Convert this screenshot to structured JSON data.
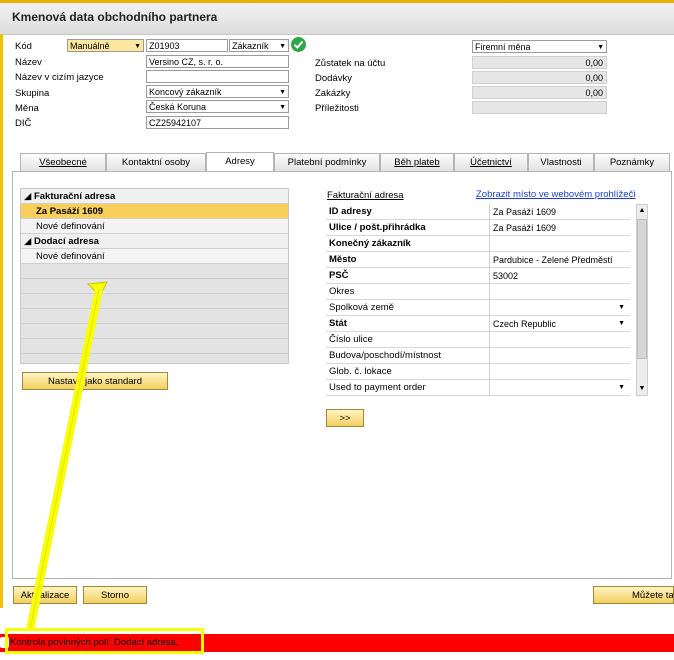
{
  "window": {
    "title": "Kmenová data obchodního partnera"
  },
  "header_left": {
    "kod_label": "Kód",
    "kod_mode": "Manuálně",
    "kod_value": "Z01903",
    "kod_type": "Zákazník",
    "nazev_label": "Název",
    "nazev_value": "Versino CZ, s. r. o.",
    "nazev_cizi_label": "Název v cizím jazyce",
    "nazev_cizi_value": "",
    "skupina_label": "Skupina",
    "skupina_value": "Koncový zákazník",
    "mena_label": "Měna",
    "mena_value": "Česká Koruna",
    "dic_label": "DIČ",
    "dic_value": "CZ25942107"
  },
  "header_right": {
    "currency_select": "Firemní měna",
    "zustatek_label": "Zůstatek na účtu",
    "zustatek_value": "0,00",
    "dodavky_label": "Dodávky",
    "dodavky_value": "0,00",
    "zakazky_label": "Zakázky",
    "zakazky_value": "0,00",
    "prilezitosti_label": "Příležitosti",
    "prilezitosti_value": ""
  },
  "tabs": [
    {
      "label": "Všeobecné"
    },
    {
      "label": "Kontaktní osoby"
    },
    {
      "label": "Adresy"
    },
    {
      "label": "Platební podmínky"
    },
    {
      "label": "Běh plateb"
    },
    {
      "label": "Účetnictví"
    },
    {
      "label": "Vlastnosti"
    },
    {
      "label": "Poznámky"
    }
  ],
  "address_tree": {
    "billing_header": "Fakturační adresa",
    "billing_selected": "Za Pasáží 1609",
    "billing_new": "Nové definování",
    "shipping_header": "Dodací adresa",
    "shipping_new": "Nové definování",
    "set_default_button": "Nastavit jako standard"
  },
  "address_detail": {
    "section_title": "Fakturační adresa",
    "browser_link": "Zobrazit místo ve webovém prohlížeči",
    "rows": [
      {
        "key": "ID adresy",
        "value": "Za Pasáží 1609"
      },
      {
        "key": "Ulice / pošt.přihrádka",
        "value": "Za Pasáží 1609"
      },
      {
        "key": "Konečný zákazník",
        "value": ""
      },
      {
        "key": "Město",
        "value": "Pardubice - Zelené Předměstí"
      },
      {
        "key": "PSČ",
        "value": "53002"
      },
      {
        "key": "Okres",
        "value": ""
      },
      {
        "key": "Spolková země",
        "value": ""
      },
      {
        "key": "Stát",
        "value": "Czech Republic"
      },
      {
        "key": "Číslo ulice",
        "value": ""
      },
      {
        "key": "Budova/poschodí/místnost",
        "value": ""
      },
      {
        "key": "Glob. č. lokace",
        "value": ""
      },
      {
        "key": "Used to payment order",
        "value": ""
      }
    ],
    "more_button": ">>"
  },
  "footer": {
    "update_button": "Aktualizace",
    "cancel_button": "Storno",
    "right_button": "Můžete ta"
  },
  "status": {
    "message": "Kontrola povinných polí: Dodací adresa,"
  },
  "colors": {
    "accent_yellow": "#f8ff00",
    "status_red": "#ff0000",
    "selected_row": "#f9cf5c"
  }
}
